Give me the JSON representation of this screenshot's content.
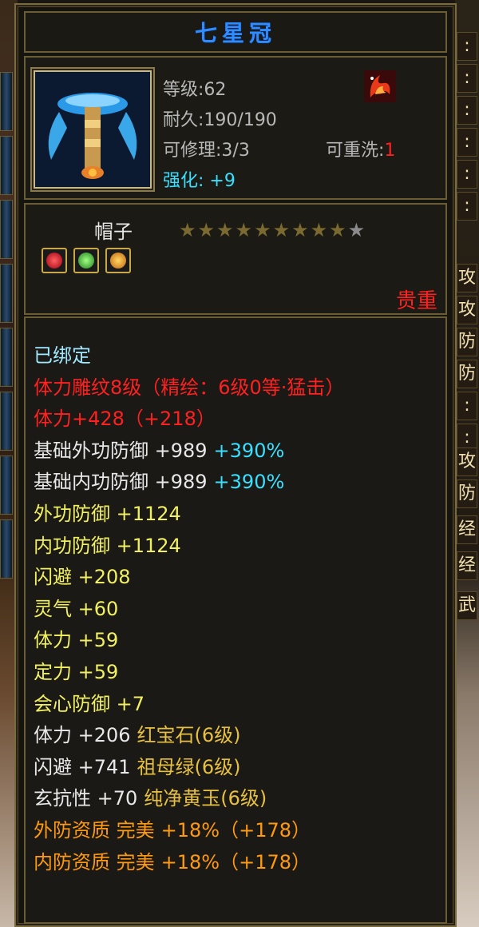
{
  "item": {
    "name": "七星冠",
    "level_label": "等级:62",
    "durability_label": "耐久:190/190",
    "repair_label": "可修理:3/3",
    "rewash_label": "可重洗:",
    "rewash_value": "1",
    "enhance_label": "强化: +9",
    "type_label": "帽子",
    "stars_filled": 9,
    "stars_total": 10,
    "rarity_label": "贵重",
    "icon": "crown-helmet-icon",
    "badge_icon": "fire-wing-icon",
    "gem_icons": [
      "red-gem-icon",
      "green-gem-icon",
      "yellow-gem-icon"
    ]
  },
  "stats": [
    {
      "text": "已绑定",
      "extra": "",
      "color": "blue"
    },
    {
      "text": "体力雕纹8级（精绘：6级0等·猛击）",
      "extra": "",
      "color": "red"
    },
    {
      "text": "体力+428（+218）",
      "extra": "",
      "color": "red"
    },
    {
      "text": "基础外功防御 +989",
      "extra": "+390%",
      "color": "white"
    },
    {
      "text": "基础内功防御 +989",
      "extra": "+390%",
      "color": "white"
    },
    {
      "text": "外功防御 +1124",
      "extra": "",
      "color": "yellow"
    },
    {
      "text": "内功防御 +1124",
      "extra": "",
      "color": "yellow"
    },
    {
      "text": "闪避 +208",
      "extra": "",
      "color": "yellow"
    },
    {
      "text": "灵气 +60",
      "extra": "",
      "color": "yellow"
    },
    {
      "text": "体力 +59",
      "extra": "",
      "color": "yellow"
    },
    {
      "text": "定力 +59",
      "extra": "",
      "color": "yellow"
    },
    {
      "text": "会心防御 +7",
      "extra": "",
      "color": "yellow"
    },
    {
      "text": "体力 +206",
      "extra": "红宝石(6级)",
      "color": "white-gold"
    },
    {
      "text": "闪避 +741",
      "extra": "祖母绿(6级)",
      "color": "white-gold"
    },
    {
      "text": "玄抗性 +70",
      "extra": "纯净黄玉(6级)",
      "color": "white-gold"
    },
    {
      "text": "外防资质  完美",
      "extra": "+18%（+178）",
      "color": "orange"
    },
    {
      "text": "内防资质  完美",
      "extra": "+18%（+178）",
      "color": "orange"
    }
  ],
  "right_edge_chars": [
    ":",
    ":",
    ":",
    ":",
    ":",
    ":",
    "攻",
    "攻",
    "防",
    "防",
    ":",
    ":",
    "攻",
    "防",
    "经",
    "经",
    "武"
  ]
}
